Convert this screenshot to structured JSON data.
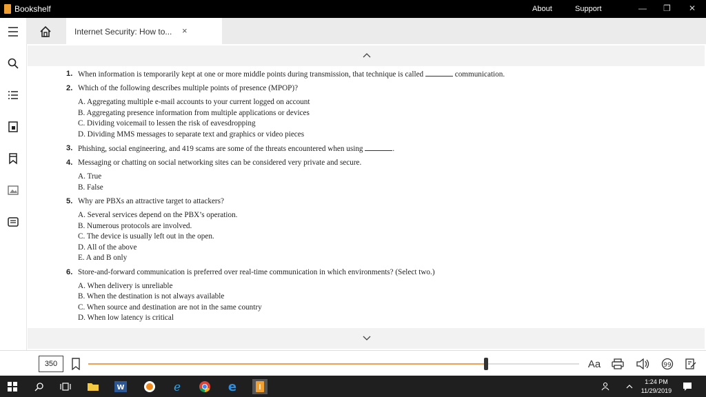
{
  "app": {
    "title": "Bookshelf"
  },
  "titlebar": {
    "about": "About",
    "support": "Support"
  },
  "tab": {
    "title": "Internet Security: How to...",
    "close": "×"
  },
  "questions": [
    {
      "num": "1.",
      "text_a": "When information is temporarily kept at one or more middle points during transmission, that technique is called",
      "text_b": "communication."
    },
    {
      "num": "2.",
      "text": "Which of the following describes multiple points of presence (MPOP)?",
      "options": [
        "A.  Aggregating multiple e-mail accounts to your current logged on account",
        "B.  Aggregating presence information from multiple applications or devices",
        "C.  Dividing voicemail to lessen the risk of eavesdropping",
        "D.  Dividing MMS messages to separate text and graphics or video pieces"
      ]
    },
    {
      "num": "3.",
      "text_a": "Phishing, social engineering, and 419 scams are some of the threats encountered when using",
      "text_b": "."
    },
    {
      "num": "4.",
      "text": "Messaging or chatting on social networking sites can be considered very private and secure.",
      "options": [
        "A.  True",
        "B.  False"
      ]
    },
    {
      "num": "5.",
      "text": "Why are PBXs an attractive target to attackers?",
      "options": [
        "A.  Several services depend on the PBX’s operation.",
        "B.  Numerous protocols are involved.",
        "C.  The device is usually left out in the open.",
        "D.  All of the above",
        "E.  A and B only"
      ]
    },
    {
      "num": "6.",
      "text": "Store-and-forward communication is preferred over real-time communication in which environments? (Select two.)",
      "options": [
        "A.  When delivery is unreliable",
        "B.  When the destination is not always available",
        "C.  When source and destination are not in the same country",
        "D.  When low latency is critical"
      ]
    }
  ],
  "footer": {
    "page": "350",
    "progress": 0.81,
    "font_label": "Aa"
  },
  "taskbar": {
    "time": "1:24 PM",
    "date": "11/29/2019"
  },
  "colors": {
    "accent": "#f0a050",
    "brand": "#f0a030"
  }
}
